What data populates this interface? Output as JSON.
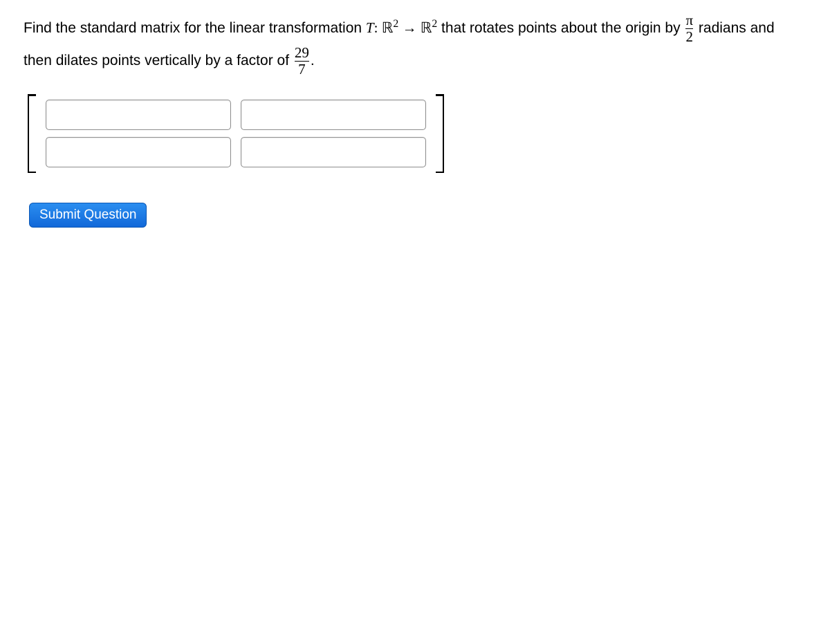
{
  "question": {
    "part1": "Find the standard matrix for the linear transformation ",
    "T": "T",
    "colon": ": ",
    "R": "ℝ",
    "exp2a": "2",
    "arrow": " → ",
    "exp2b": "2",
    "part2": " that rotates points about the origin by ",
    "frac1_num": "π",
    "frac1_den": "2",
    "part3": " radians and then dilates points vertically by a factor of ",
    "frac2_num": "29",
    "frac2_den": "7",
    "period": "."
  },
  "matrix": {
    "cells": [
      {
        "value": "",
        "name": "matrix-cell-1-1"
      },
      {
        "value": "",
        "name": "matrix-cell-1-2"
      },
      {
        "value": "",
        "name": "matrix-cell-2-1"
      },
      {
        "value": "",
        "name": "matrix-cell-2-2"
      }
    ]
  },
  "actions": {
    "submit_label": "Submit Question"
  }
}
